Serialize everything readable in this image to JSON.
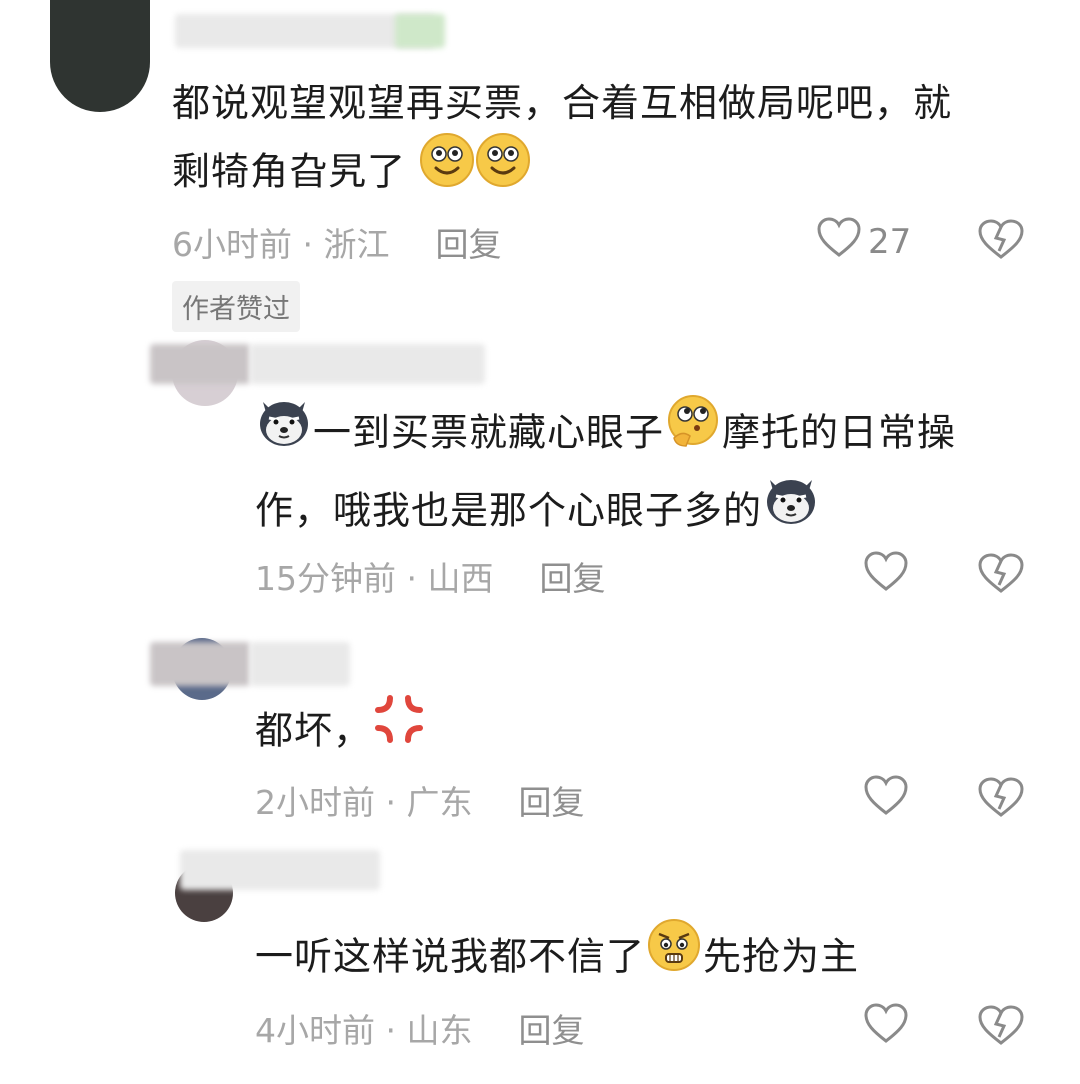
{
  "comments": [
    {
      "text_line1": "都说观望观望再买票，合着互相做局呢吧，就",
      "text_line2": "剩犄角旮旯了",
      "time": "6小时前",
      "location": "浙江",
      "reply": "回复",
      "likes": "27",
      "badge": "作者赞过",
      "icons": [
        "smile-emoji-icon",
        "smile-emoji-icon",
        "heart-outline-icon",
        "broken-heart-icon"
      ]
    },
    {
      "text_part1": "一到买票就藏心眼子",
      "text_part2": "摩托的日常操",
      "text_line2": "作，哦我也是那个心眼子多的",
      "time": "15分钟前",
      "location": "山西",
      "reply": "回复",
      "icons": [
        "husky-emoji-icon",
        "thinking-emoji-icon",
        "husky-emoji-icon",
        "heart-outline-icon",
        "broken-heart-icon"
      ]
    },
    {
      "text": "都坏，",
      "time": "2小时前",
      "location": "广东",
      "reply": "回复",
      "icons": [
        "anger-symbol-icon",
        "heart-outline-icon",
        "broken-heart-icon"
      ]
    },
    {
      "text_part1": "一听这样说我都不信了",
      "text_part2": "先抢为主",
      "time": "4小时前",
      "location": "山东",
      "reply": "回复",
      "icons": [
        "worried-emoji-icon",
        "heart-outline-icon",
        "broken-heart-icon"
      ]
    }
  ],
  "separator": " · ",
  "colors": {
    "text": "#1c1c1c",
    "meta": "#a7a7a7",
    "icon": "#8a8a8a",
    "anger": "#e0463c",
    "emoji_yellow": "#f7c948"
  }
}
